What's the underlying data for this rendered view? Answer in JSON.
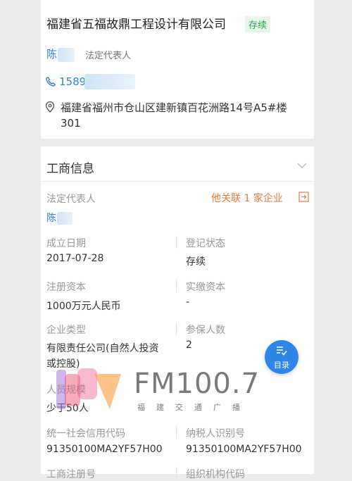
{
  "company": {
    "name": "福建省五福故鼎工程设计有限公司",
    "status": "存续",
    "legal_rep_name": "陈",
    "legal_rep_role": "法定代表人",
    "phone": "1589",
    "address": "福建省福州市仓山区建新镇百花洲路14号A5#楼301"
  },
  "business_info": {
    "title": "工商信息",
    "legal_rep_label": "法定代表人",
    "legal_rep_name": "陈",
    "related_link": "他关联 1 家企业",
    "fields": [
      {
        "label": "成立日期",
        "value": "2017-07-28"
      },
      {
        "label": "登记状态",
        "value": "存续"
      },
      {
        "label": "注册资本",
        "value": "1000万元人民币"
      },
      {
        "label": "实缴资本",
        "value": "-"
      },
      {
        "label": "企业类型",
        "value": "有限责任公司(自然人投资或控股)"
      },
      {
        "label": "参保人数",
        "value": "2"
      },
      {
        "label": "人员规模",
        "value": "少于50人"
      },
      {
        "label": "统一社会信用代码",
        "value": "91350100MA2YF57H00"
      },
      {
        "label": "纳税人识别号",
        "value": "91350100MA2YF57H00"
      },
      {
        "label": "工商注册号",
        "value": ""
      },
      {
        "label": "组织机构代码",
        "value": ""
      }
    ]
  },
  "toc_button": {
    "label": "目录"
  },
  "watermark": {
    "brand": "FM100.7",
    "subtitle": "福建交通广播"
  },
  "colors": {
    "link": "#2f7ee8",
    "status_green": "#2aa84a",
    "orange": "#e8783a",
    "toc_blue": "#2d87ea"
  }
}
